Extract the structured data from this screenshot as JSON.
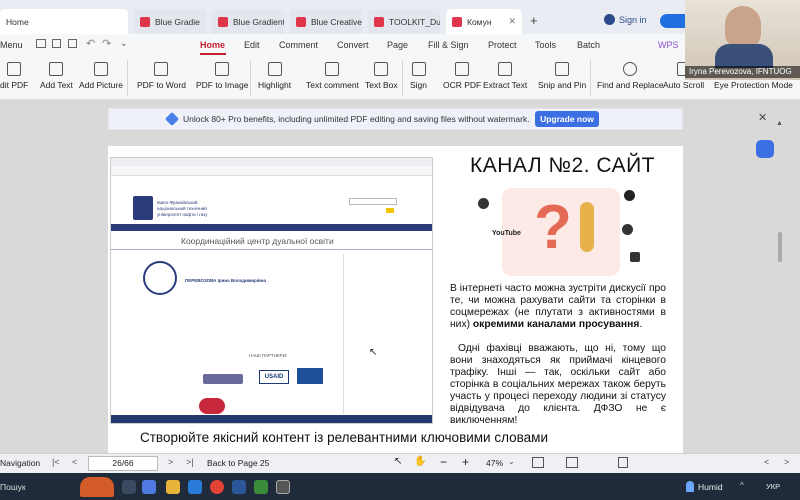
{
  "tabs": [
    {
      "label": "Home"
    },
    {
      "label": "Blue Gradie"
    },
    {
      "label": "Blue Gradient"
    },
    {
      "label": "Blue Creative"
    },
    {
      "label": "TOOLKIT_Duali"
    },
    {
      "label": "Комун"
    }
  ],
  "tabbar": {
    "sign_in": "Sign in",
    "new_tab": "+"
  },
  "menubar": {
    "menu_label": "Menu",
    "items": [
      "Home",
      "Edit",
      "Comment",
      "Convert",
      "Page",
      "Fill & Sign",
      "Protect",
      "Tools",
      "Batch"
    ],
    "active": "Home",
    "wps": "WPS"
  },
  "toolbar": {
    "items": [
      "dit PDF",
      "Add Text",
      "Add Picture",
      "PDF to Word",
      "PDF to Image",
      "Highlight",
      "Text comment",
      "Text Box",
      "Sign",
      "OCR PDF",
      "Extract Text",
      "Snip and Pin",
      "Find and Replace",
      "Auto Scroll",
      "Eye Protection Mode"
    ]
  },
  "banner": {
    "text": "Unlock 80+ Pro benefits, including unlimited PDF editing and saving files without watermark.",
    "button": "Upgrade now"
  },
  "slide": {
    "title": "КАНАЛ №2. САЙТ",
    "para1_plain": "В інтернеті часто можна зустріти дискусії про те, чи можна рахувати сайти та сторінки в соцмережах (не плутати з активностями в них) ",
    "para1_bold": "окремими каналами просування",
    "para1_end": ".",
    "para2": "Одні фахівці вважають, що ні, тому що вони знаходяться як приймачі кінцевого трафіку. Інші — так, оскільки сайт або сторінка в соціальних мережах також беруть участь у процесі переходу людини зі статусу відвідувача до клієнта. ДФЗО не є виключенням!",
    "bottom": "Створюйте якісний контент із релевантними ключовими словами",
    "illustration_labels": [
      "YouTube"
    ]
  },
  "web": {
    "header_name": "Івано-Франківський національний технічний університет нафти і газу",
    "heading": "Координаційний центр дуальної освіти",
    "person": "ПЕРЕВОЗОВА Ірина Володимирівна",
    "partners_label": "НАШІ ПАРТНЕРИ:",
    "usaid": "USAID"
  },
  "status": {
    "navigation": "Navigation",
    "page": "26/66",
    "back": "Back to Page 25",
    "zoom": "47%"
  },
  "taskbar": {
    "search": "Пошук",
    "weather": "Humid",
    "lang": "УКР"
  },
  "cam": {
    "name": "Iryna Perevozova, IFNTUOG"
  }
}
